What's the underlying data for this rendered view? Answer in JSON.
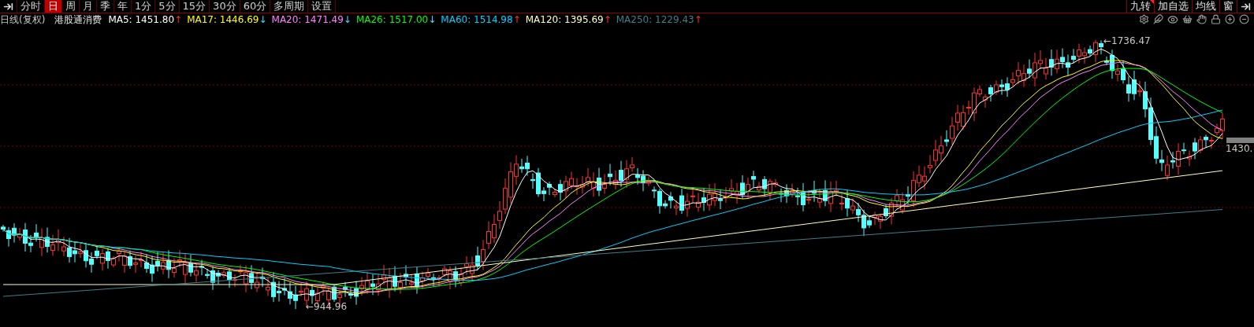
{
  "toolbar": {
    "tabs": [
      {
        "label": "分时",
        "selected": false
      },
      {
        "label": "日",
        "selected": true
      },
      {
        "label": "周",
        "selected": false
      },
      {
        "label": "月",
        "selected": false
      },
      {
        "label": "季",
        "selected": false
      },
      {
        "label": "年",
        "selected": false
      },
      {
        "label": "1分",
        "selected": false
      },
      {
        "label": "5分",
        "selected": false
      },
      {
        "label": "15分",
        "selected": false
      },
      {
        "label": "30分",
        "selected": false
      },
      {
        "label": "60分",
        "selected": false
      },
      {
        "label": "多周期",
        "selected": false
      },
      {
        "label": "设置",
        "selected": false
      }
    ],
    "right_buttons": [
      {
        "label": "九转",
        "flagged": true
      },
      {
        "label": "加自选",
        "flagged": false
      },
      {
        "label": "均线",
        "flagged": false
      },
      {
        "label": "窗",
        "flagged": false
      }
    ]
  },
  "legend": {
    "period": "日线(复权)",
    "name": "港股通消费",
    "indicators": [
      {
        "name": "MA5:",
        "value": "1451.80",
        "arrow": "↑",
        "rising": true,
        "color": "#ffffff"
      },
      {
        "name": "MA17:",
        "value": "1446.69",
        "arrow": "↓",
        "rising": false,
        "color": "#ffff00"
      },
      {
        "name": "MA20:",
        "value": "1471.49",
        "arrow": "↓",
        "rising": false,
        "color": "#ff80ff"
      },
      {
        "name": "MA26:",
        "value": "1517.00",
        "arrow": "↓",
        "rising": false,
        "color": "#00ff00"
      },
      {
        "name": "MA60:",
        "value": "1514.98",
        "arrow": "↑",
        "rising": true,
        "color": "#00d0ff"
      },
      {
        "name": "MA120:",
        "value": "1395.69",
        "arrow": "↑",
        "rising": true,
        "color": "#ffffc0"
      },
      {
        "name": "MA250:",
        "value": "1229.43",
        "arrow": "↑",
        "rising": true,
        "color": "#3e7f8a"
      }
    ]
  },
  "chart": {
    "high_label": "←1736.47",
    "low_label": "←944.96",
    "price_label": "1430."
  }
}
